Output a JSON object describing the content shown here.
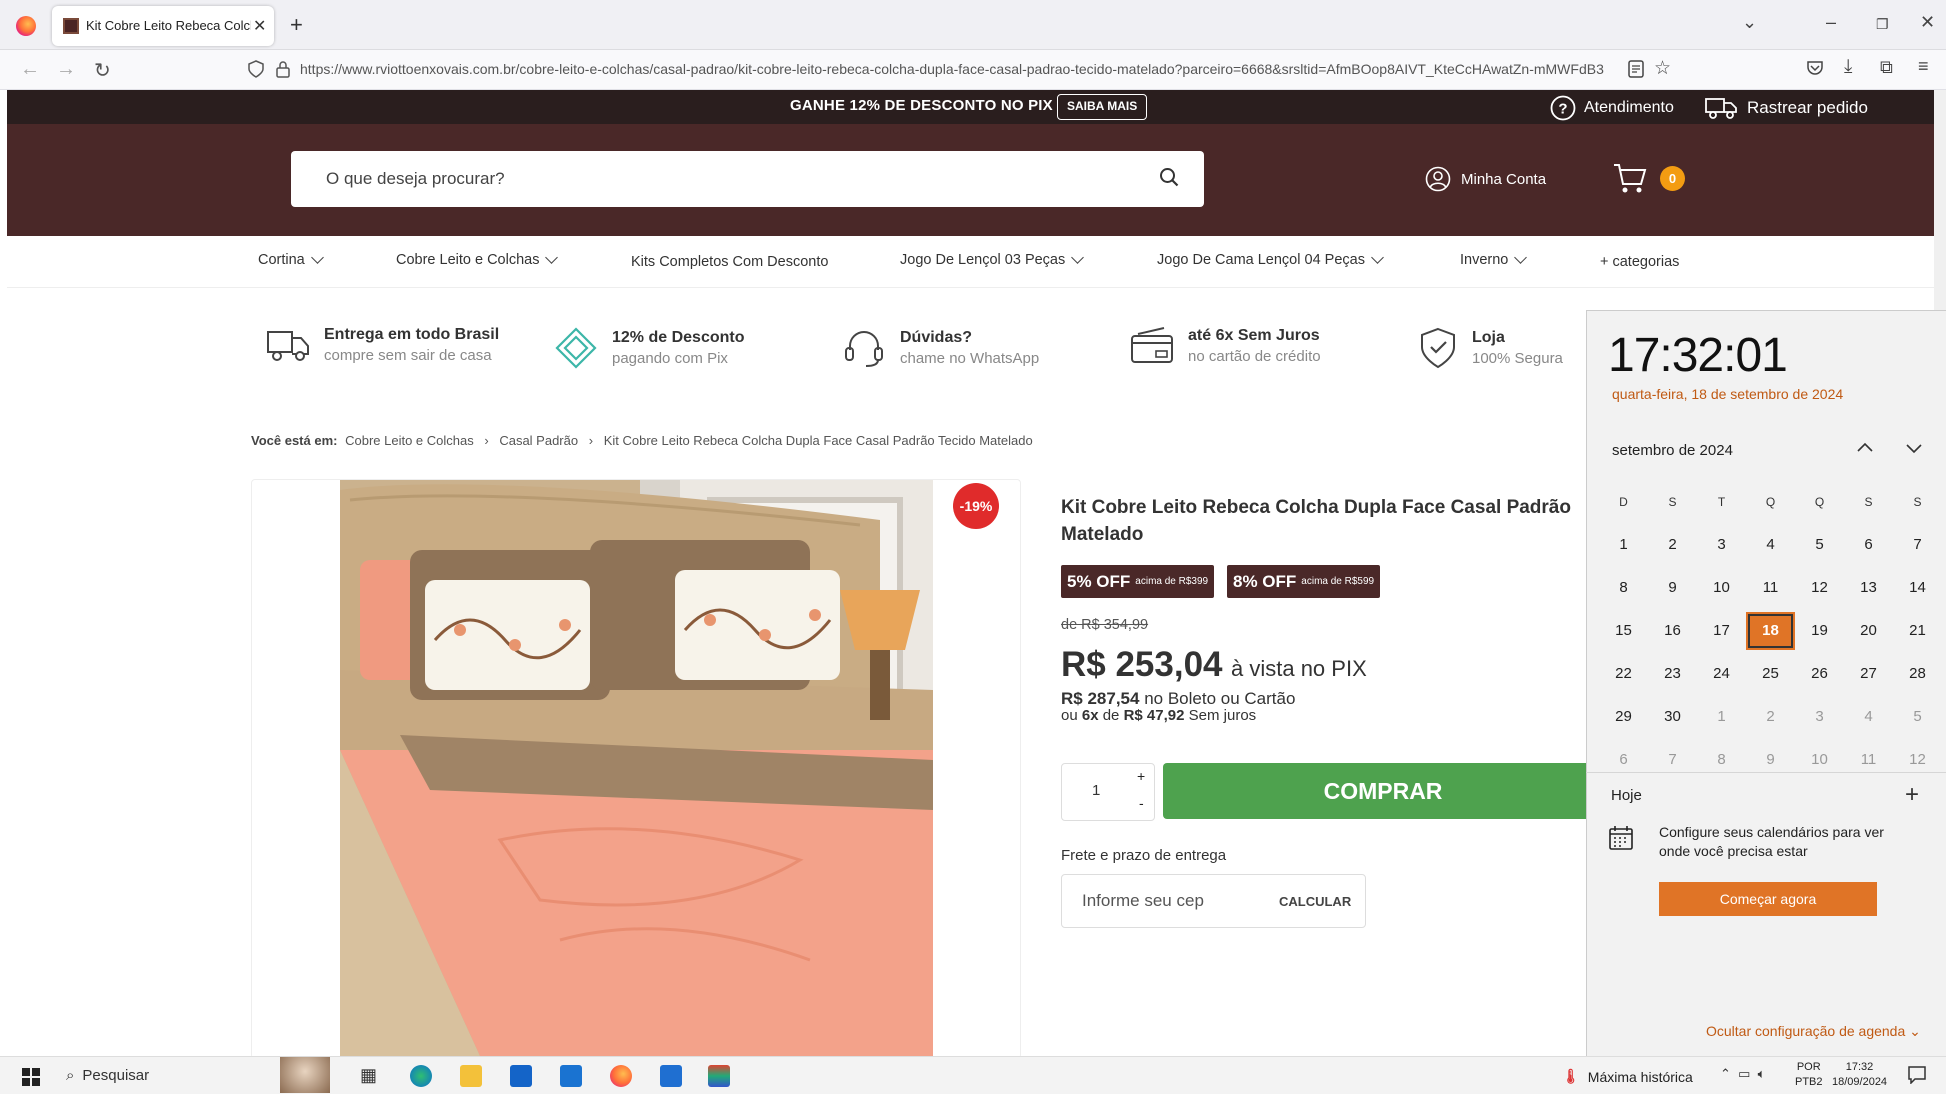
{
  "browser": {
    "tab_title": "Kit Cobre Leito Rebeca Colcha D",
    "url": "https://www.rviottoenxovais.com.br/cobre-leito-e-colchas/casal-padrao/kit-cobre-leito-rebeca-colcha-dupla-face-casal-padrao-tecido-matelado?parceiro=6668&srsltid=AfmBOop8AIVT_KteCcHAwatZn-mMWFdB3"
  },
  "promo": {
    "text": "GANHE 12% DE DESCONTO NO PIX",
    "button": "SAIBA MAIS",
    "atendimento": "Atendimento",
    "rastrear": "Rastrear pedido"
  },
  "header": {
    "search_placeholder": "O que deseja procurar?",
    "account": "Minha Conta",
    "cart_count": "0"
  },
  "menu": [
    "Cortina",
    "Cobre Leito e Colchas",
    "Kits Completos Com Desconto",
    "Jogo De Lençol 03 Peças",
    "Jogo De Cama Lençol 04 Peças",
    "Inverno",
    "+ categorias"
  ],
  "benefits": [
    {
      "title": "Entrega em todo Brasil",
      "subtitle": "compre sem sair de casa",
      "icon": "truck-icon"
    },
    {
      "title": "12% de Desconto",
      "subtitle": "pagando com Pix",
      "icon": "pix-icon"
    },
    {
      "title": "Dúvidas?",
      "subtitle": "chame no WhatsApp",
      "icon": "headset-icon"
    },
    {
      "title": "até 6x Sem Juros",
      "subtitle": "no cartão de crédito",
      "icon": "credit-card-icon"
    },
    {
      "title": "Loja",
      "subtitle": "100% Segura",
      "icon": "shield-check-icon"
    }
  ],
  "breadcrumb": {
    "label": "Você está em:",
    "items": [
      "Cobre Leito e Colchas",
      "Casal Padrão",
      "Kit Cobre Leito Rebeca Colcha Dupla Face Casal Padrão Tecido Matelado"
    ]
  },
  "product": {
    "discount_badge": "-19%",
    "title": "Kit Cobre Leito Rebeca Colcha Dupla Face Casal Padrão Matelado",
    "offers": [
      {
        "big": "5% OFF",
        "small": "acima de R$399"
      },
      {
        "big": "8% OFF",
        "small": "acima de R$599"
      }
    ],
    "old_price": "de R$ 354,99",
    "price": "R$ 253,04",
    "price_suffix": "à vista no PIX",
    "boleto_price": "R$ 287,54",
    "boleto_text": "no Boleto ou Cartão",
    "installments_prefix": "ou",
    "installments_count": "6x",
    "installments_de": "de",
    "installments_value": "R$ 47,92",
    "installments_suffix": "Sem juros",
    "quantity": "1",
    "plus": "+",
    "minus": "-",
    "buy_button": "COMPRAR",
    "shipping_label": "Frete e prazo de entrega",
    "cep_placeholder": "Informe seu cep",
    "calc_button": "CALCULAR"
  },
  "calendar": {
    "time": "17:32:01",
    "date_line": "quarta-feira, 18 de setembro de 2024",
    "month": "setembro de 2024",
    "weekdays": [
      "D",
      "S",
      "T",
      "Q",
      "Q",
      "S",
      "S"
    ],
    "weeks": [
      [
        "1",
        "2",
        "3",
        "4",
        "5",
        "6",
        "7"
      ],
      [
        "8",
        "9",
        "10",
        "11",
        "12",
        "13",
        "14"
      ],
      [
        "15",
        "16",
        "17",
        "18",
        "19",
        "20",
        "21"
      ],
      [
        "22",
        "23",
        "24",
        "25",
        "26",
        "27",
        "28"
      ],
      [
        "29",
        "30",
        "1",
        "2",
        "3",
        "4",
        "5"
      ],
      [
        "6",
        "7",
        "8",
        "9",
        "10",
        "11",
        "12"
      ]
    ],
    "today": "18",
    "today_label": "Hoje",
    "agenda_text": "Configure seus calendários para ver onde você precisa estar",
    "start_button": "Começar agora",
    "hide_link": "Ocultar configuração de agenda",
    "accent": "#e07426"
  },
  "taskbar": {
    "search": "Pesquisar",
    "weather": "Máxima histórica",
    "lang1": "POR",
    "lang2": "PTB2",
    "time": "17:32",
    "date": "18/09/2024"
  }
}
